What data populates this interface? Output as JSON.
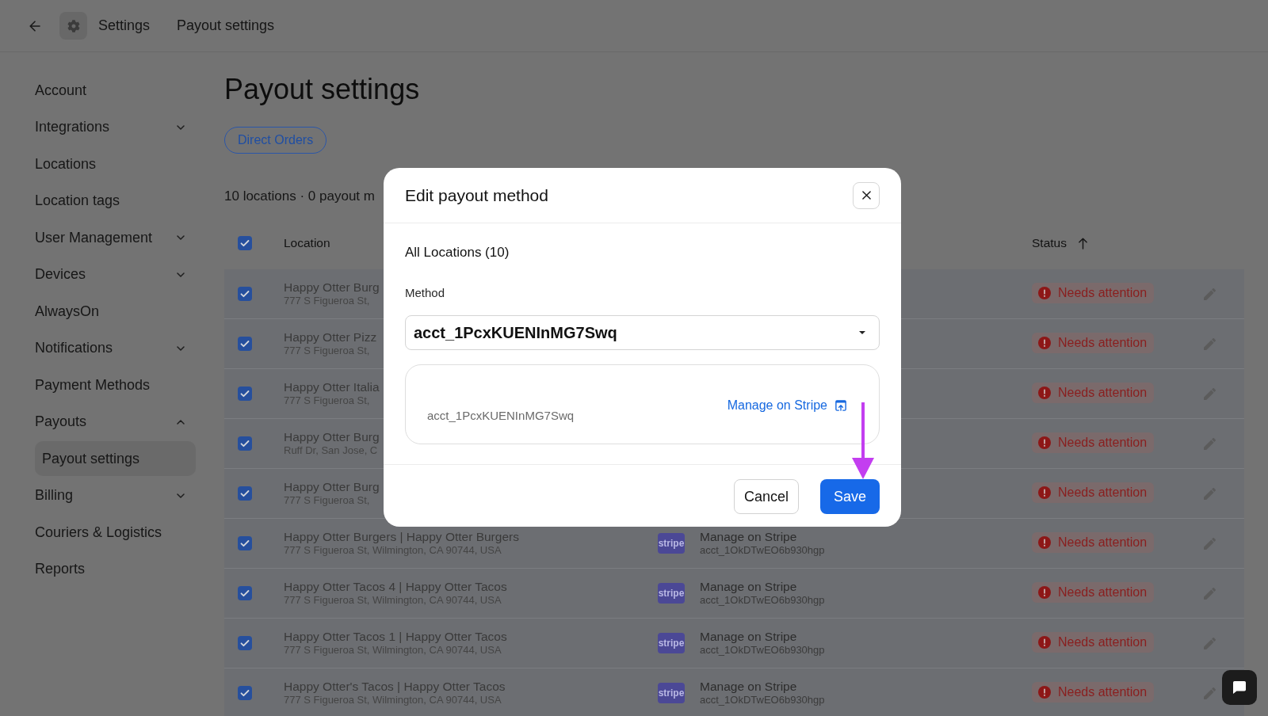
{
  "header": {
    "breadcrumbs": [
      "Settings",
      "Payout settings"
    ]
  },
  "sidebar": {
    "items": [
      {
        "label": "Account",
        "kind": "link",
        "selected": false
      },
      {
        "label": "Integrations",
        "kind": "group",
        "expanded": false,
        "selected": false
      },
      {
        "label": "Locations",
        "kind": "link",
        "selected": false
      },
      {
        "label": "Location tags",
        "kind": "link",
        "selected": false
      },
      {
        "label": "User Management",
        "kind": "group",
        "expanded": false,
        "selected": false
      },
      {
        "label": "Devices",
        "kind": "group",
        "expanded": false,
        "selected": false
      },
      {
        "label": "AlwaysOn",
        "kind": "link",
        "selected": false
      },
      {
        "label": "Notifications",
        "kind": "group",
        "expanded": false,
        "selected": false
      },
      {
        "label": "Payment Methods",
        "kind": "link",
        "selected": false
      },
      {
        "label": "Payouts",
        "kind": "group",
        "expanded": true,
        "selected": false,
        "children": [
          {
            "label": "Payout settings",
            "selected": true
          }
        ]
      },
      {
        "label": "Billing",
        "kind": "group",
        "expanded": false,
        "selected": false
      },
      {
        "label": "Couriers & Logistics",
        "kind": "link",
        "selected": false
      },
      {
        "label": "Reports",
        "kind": "link",
        "selected": false
      }
    ]
  },
  "page": {
    "title": "Payout settings",
    "filters": [
      {
        "label": "Direct Orders",
        "selected": true
      }
    ],
    "summary": "10 locations · 0 payout m"
  },
  "table": {
    "all_checked": true,
    "columns": [
      {
        "label": "Location",
        "sorted": false
      },
      {
        "label": "Status",
        "sorted": true
      }
    ],
    "rows": [
      {
        "checked": true,
        "name": "Happy Otter Burg",
        "address": "777 S Figueroa St,",
        "status": {
          "label": "Needs attention",
          "kind": "warning"
        }
      },
      {
        "checked": true,
        "name": "Happy Otter Pizz",
        "address": "777 S Figueroa St,",
        "status": {
          "label": "Needs attention",
          "kind": "warning"
        }
      },
      {
        "checked": true,
        "name": "Happy Otter Italia",
        "address": "777 S Figueroa St,",
        "status": {
          "label": "Needs attention",
          "kind": "warning"
        }
      },
      {
        "checked": true,
        "name": "Happy Otter Burg",
        "address": "Ruff Dr, San Jose, C",
        "status": {
          "label": "Needs attention",
          "kind": "warning"
        }
      },
      {
        "checked": true,
        "name": "Happy Otter Burg",
        "address": "777 S Figueroa St,",
        "status": {
          "label": "Needs attention",
          "kind": "warning"
        }
      },
      {
        "checked": true,
        "name": "Happy Otter Burgers | Happy Otter Burgers",
        "address": "777 S Figueroa St, Wilmington, CA 90744, USA",
        "method": {
          "logo": "stripe",
          "label": "Manage on Stripe",
          "account": "acct_1OkDTwEO6b930hgp"
        },
        "status": {
          "label": "Needs attention",
          "kind": "warning"
        }
      },
      {
        "checked": true,
        "name": "Happy Otter Tacos 4 | Happy Otter Tacos",
        "address": "777 S Figueroa St, Wilmington, CA 90744, USA",
        "method": {
          "logo": "stripe",
          "label": "Manage on Stripe",
          "account": "acct_1OkDTwEO6b930hgp"
        },
        "status": {
          "label": "Needs attention",
          "kind": "warning"
        }
      },
      {
        "checked": true,
        "name": "Happy Otter Tacos 1 | Happy Otter Tacos",
        "address": "777 S Figueroa St, Wilmington, CA 90744, USA",
        "method": {
          "logo": "stripe",
          "label": "Manage on Stripe",
          "account": "acct_1OkDTwEO6b930hgp"
        },
        "status": {
          "label": "Needs attention",
          "kind": "warning"
        }
      },
      {
        "checked": true,
        "name": "Happy Otter's Tacos | Happy Otter Tacos",
        "address": "777 S Figueroa St, Wilmington, CA 90744, USA",
        "method": {
          "logo": "stripe",
          "label": "Manage on Stripe",
          "account": "acct_1OkDTwEO6b930hgp"
        },
        "status": {
          "label": "Needs attention",
          "kind": "warning"
        }
      }
    ]
  },
  "dialog": {
    "title": "Edit payout method",
    "scope": "All Locations (10)",
    "field": {
      "label": "Method",
      "value": "acct_1PcxKUENInMG7Swq"
    },
    "account": {
      "id": "acct_1PcxKUENInMG7Swq",
      "link": "Manage on Stripe"
    },
    "buttons": [
      {
        "label": "Cancel",
        "kind": "secondary"
      },
      {
        "label": "Save",
        "kind": "primary"
      }
    ],
    "annotation": {
      "kind": "arrow"
    }
  }
}
